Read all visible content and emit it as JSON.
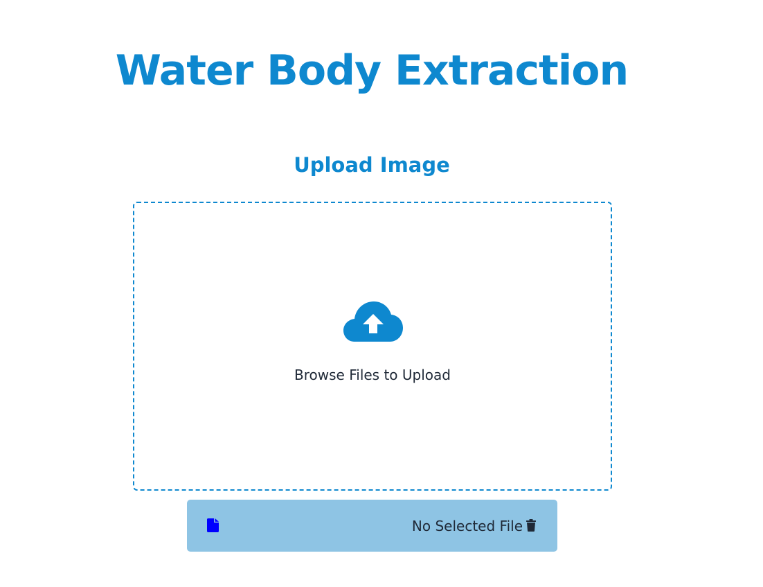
{
  "page": {
    "title": "Water Body Extraction",
    "subtitle": "Upload Image"
  },
  "dropzone": {
    "label": "Browse Files to Upload",
    "icon": "cloud-upload-icon"
  },
  "file_bar": {
    "status_text": "No Selected File",
    "file_icon": "file-icon",
    "delete_icon": "trash-icon"
  },
  "colors": {
    "accent": "#0e88cf",
    "file_bar_bg": "#8ec4e4",
    "file_icon": "#0000ff",
    "text": "#1f2937"
  }
}
